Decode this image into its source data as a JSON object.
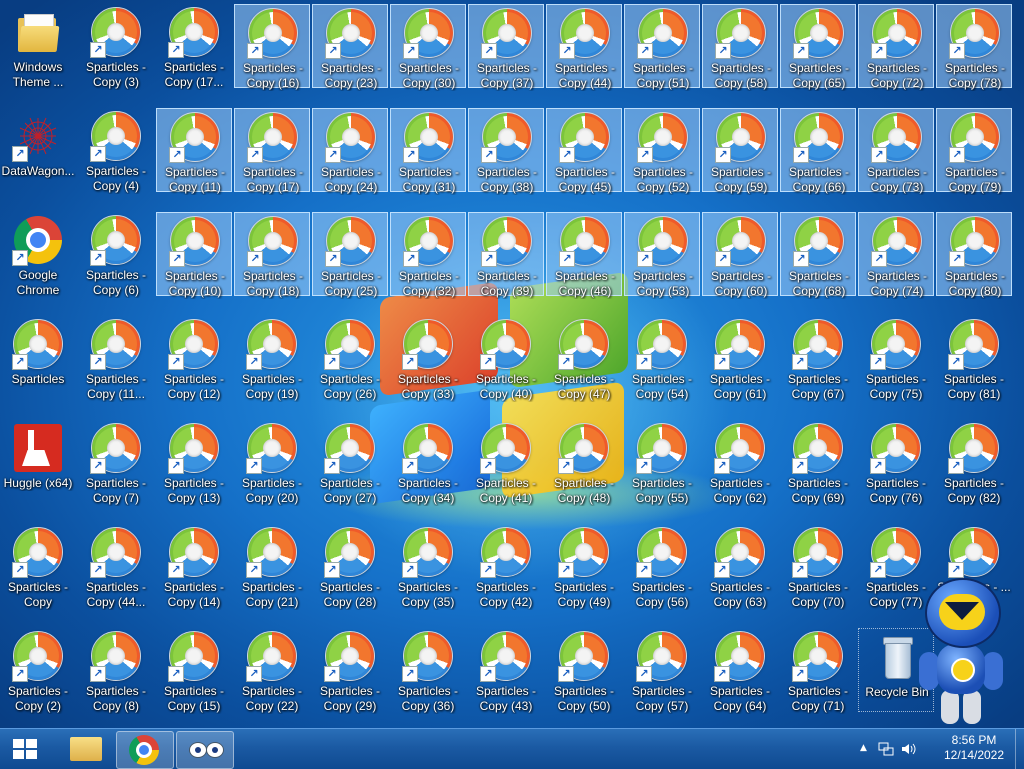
{
  "desktop": {
    "system_icons": {
      "windows_theme": "Windows Theme ...",
      "datawagon": "DataWagon...",
      "google_chrome": "Google Chrome",
      "sparticles": "Sparticles",
      "huggle": "Huggle (x64)",
      "recycle_bin": "Recycle Bin"
    },
    "sparticles_shortcuts": [
      {
        "label": "Sparticles - Copy (3)",
        "selected": false
      },
      {
        "label": "Sparticles - Copy (4)",
        "selected": false
      },
      {
        "label": "Sparticles - Copy (6)",
        "selected": false
      },
      {
        "label": "Sparticles - Copy (11...",
        "selected": false
      },
      {
        "label": "Sparticles - Copy (7)",
        "selected": false
      },
      {
        "label": "Sparticles - Copy (44...",
        "selected": false
      },
      {
        "label": "Sparticles - Copy (8)",
        "selected": false
      },
      {
        "label": "Sparticles - Copy (17...",
        "selected": false
      },
      {
        "label": "Sparticles - Copy (11)",
        "selected": true
      },
      {
        "label": "Sparticles - Copy (10)",
        "selected": true
      },
      {
        "label": "Sparticles - Copy (12)",
        "selected": false
      },
      {
        "label": "Sparticles - Copy (13)",
        "selected": false
      },
      {
        "label": "Sparticles - Copy (14)",
        "selected": false
      },
      {
        "label": "Sparticles - Copy (15)",
        "selected": false
      },
      {
        "label": "Sparticles - Copy (16)",
        "selected": true
      },
      {
        "label": "Sparticles - Copy (17)",
        "selected": true
      },
      {
        "label": "Sparticles - Copy (18)",
        "selected": true
      },
      {
        "label": "Sparticles - Copy (19)",
        "selected": false
      },
      {
        "label": "Sparticles - Copy (20)",
        "selected": false
      },
      {
        "label": "Sparticles - Copy (21)",
        "selected": false
      },
      {
        "label": "Sparticles - Copy (22)",
        "selected": false
      },
      {
        "label": "Sparticles - Copy (23)",
        "selected": true
      },
      {
        "label": "Sparticles - Copy (24)",
        "selected": true
      },
      {
        "label": "Sparticles - Copy (25)",
        "selected": true
      },
      {
        "label": "Sparticles - Copy (26)",
        "selected": false
      },
      {
        "label": "Sparticles - Copy (27)",
        "selected": false
      },
      {
        "label": "Sparticles - Copy (28)",
        "selected": false
      },
      {
        "label": "Sparticles - Copy (29)",
        "selected": false
      },
      {
        "label": "Sparticles - Copy (30)",
        "selected": true
      },
      {
        "label": "Sparticles - Copy (31)",
        "selected": true
      },
      {
        "label": "Sparticles - Copy (32)",
        "selected": true
      },
      {
        "label": "Sparticles - Copy (33)",
        "selected": false
      },
      {
        "label": "Sparticles - Copy (34)",
        "selected": false
      },
      {
        "label": "Sparticles - Copy (35)",
        "selected": false
      },
      {
        "label": "Sparticles - Copy (36)",
        "selected": false
      },
      {
        "label": "Sparticles - Copy (37)",
        "selected": true
      },
      {
        "label": "Sparticles - Copy (38)",
        "selected": true
      },
      {
        "label": "Sparticles - Copy (39)",
        "selected": true
      },
      {
        "label": "Sparticles - Copy (40)",
        "selected": false
      },
      {
        "label": "Sparticles - Copy (41)",
        "selected": false
      },
      {
        "label": "Sparticles - Copy (42)",
        "selected": false
      },
      {
        "label": "Sparticles - Copy (43)",
        "selected": false
      },
      {
        "label": "Sparticles - Copy (44)",
        "selected": true
      },
      {
        "label": "Sparticles - Copy (45)",
        "selected": true
      },
      {
        "label": "Sparticles - Copy (46)",
        "selected": true
      },
      {
        "label": "Sparticles - Copy (47)",
        "selected": false
      },
      {
        "label": "Sparticles - Copy (48)",
        "selected": false
      },
      {
        "label": "Sparticles - Copy (49)",
        "selected": false
      },
      {
        "label": "Sparticles - Copy (50)",
        "selected": false
      },
      {
        "label": "Sparticles - Copy (51)",
        "selected": true
      },
      {
        "label": "Sparticles - Copy (52)",
        "selected": true
      },
      {
        "label": "Sparticles - Copy (53)",
        "selected": true
      },
      {
        "label": "Sparticles - Copy (54)",
        "selected": false
      },
      {
        "label": "Sparticles - Copy (55)",
        "selected": false
      },
      {
        "label": "Sparticles - Copy (56)",
        "selected": false
      },
      {
        "label": "Sparticles - Copy (57)",
        "selected": false
      },
      {
        "label": "Sparticles - Copy (58)",
        "selected": true
      },
      {
        "label": "Sparticles - Copy (59)",
        "selected": true
      },
      {
        "label": "Sparticles - Copy (60)",
        "selected": true
      },
      {
        "label": "Sparticles - Copy (61)",
        "selected": false
      },
      {
        "label": "Sparticles - Copy (62)",
        "selected": false
      },
      {
        "label": "Sparticles - Copy (63)",
        "selected": false
      },
      {
        "label": "Sparticles - Copy (64)",
        "selected": false
      },
      {
        "label": "Sparticles - Copy (65)",
        "selected": true
      },
      {
        "label": "Sparticles - Copy (66)",
        "selected": true
      },
      {
        "label": "Sparticles - Copy (68)",
        "selected": true
      },
      {
        "label": "Sparticles - Copy (67)",
        "selected": false
      },
      {
        "label": "Sparticles - Copy (69)",
        "selected": false
      },
      {
        "label": "Sparticles - Copy (70)",
        "selected": false
      },
      {
        "label": "Sparticles - Copy (71)",
        "selected": false
      },
      {
        "label": "Sparticles - Copy (72)",
        "selected": true
      },
      {
        "label": "Sparticles - Copy (73)",
        "selected": true
      },
      {
        "label": "Sparticles - Copy (74)",
        "selected": true
      },
      {
        "label": "Sparticles - Copy (75)",
        "selected": false
      },
      {
        "label": "Sparticles - Copy (76)",
        "selected": false
      },
      {
        "label": "Sparticles - Copy (77)",
        "selected": false
      },
      {
        "label": "Sparticles - Copy (78)",
        "selected": true
      },
      {
        "label": "Sparticles - Copy (79)",
        "selected": true
      },
      {
        "label": "Sparticles - Copy (80)",
        "selected": true
      },
      {
        "label": "Sparticles - Copy (81)",
        "selected": false
      },
      {
        "label": "Sparticles - Copy (82)",
        "selected": false
      },
      {
        "label": "Sparticles - Copy",
        "selected": false
      },
      {
        "label": "Sparticles - Copy (2)",
        "selected": false
      },
      {
        "label": "Sparticles - ...",
        "selected": false
      }
    ]
  },
  "taskbar": {
    "clock_time": "8:56 PM",
    "clock_date": "12/14/2022",
    "tray_chevron": "▲",
    "items": [
      "file-explorer-icon",
      "chrome-icon",
      "eyes-app-icon"
    ]
  }
}
